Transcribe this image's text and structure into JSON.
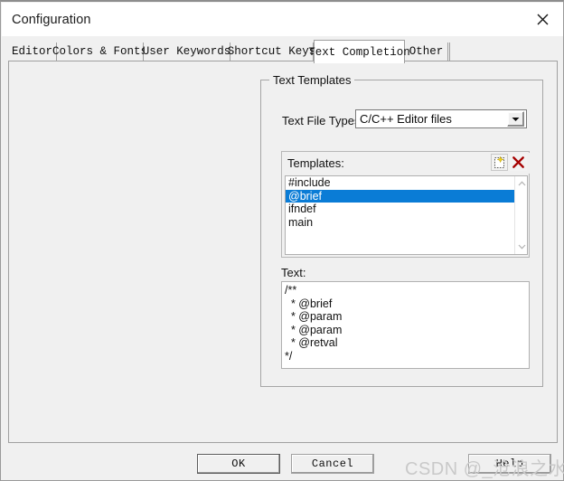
{
  "window": {
    "title": "Configuration",
    "close_icon": "close-icon"
  },
  "tabs": [
    {
      "label": "Editor",
      "active": false
    },
    {
      "label": "Colors & Fonts",
      "active": false
    },
    {
      "label": "User Keywords",
      "active": false
    },
    {
      "label": "Shortcut Keys",
      "active": false
    },
    {
      "label": "Text Completion",
      "active": true
    },
    {
      "label": "Other",
      "active": false
    }
  ],
  "group": {
    "title": "Text Templates"
  },
  "file_types": {
    "label": "Text File Types:",
    "value": "C/C++ Editor files",
    "arrow_icon": "chevron-down-icon"
  },
  "templates": {
    "label": "Templates:",
    "new_icon": "new-template-icon",
    "delete_icon": "delete-template-icon",
    "items": [
      {
        "label": "#include",
        "selected": false
      },
      {
        "label": "@brief",
        "selected": true
      },
      {
        "label": "ifndef",
        "selected": false
      },
      {
        "label": "main",
        "selected": false
      }
    ],
    "scroll_up_icon": "chevron-up-icon",
    "scroll_down_icon": "chevron-down-icon"
  },
  "text_editor": {
    "label": "Text:",
    "content": "/**\n  * @brief\n  * @param\n  * @param\n  * @retval\n*/"
  },
  "buttons": {
    "ok": "OK",
    "cancel": "Cancel",
    "help": "Help"
  },
  "watermark": {
    "text": "CSDN @_沧浪之水_"
  },
  "colors": {
    "selection": "#0a7cd6",
    "delete_icon": "#a50000",
    "window_bg": "#f0f0f0",
    "field_bg": "#ffffff"
  }
}
